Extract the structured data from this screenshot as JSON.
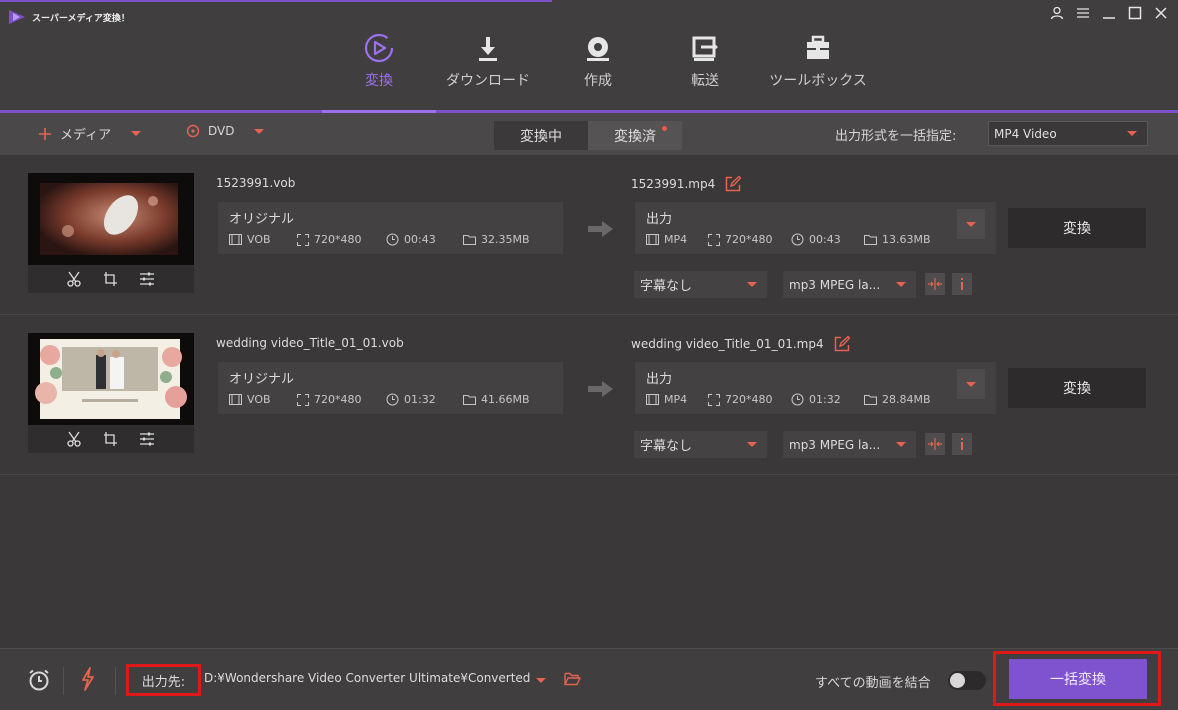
{
  "app": {
    "title": "スーパーメディア変換！"
  },
  "nav": [
    {
      "label": "変換",
      "icon": "convert-icon",
      "active": true
    },
    {
      "label": "ダウンロード",
      "icon": "download-icon"
    },
    {
      "label": "作成",
      "icon": "burn-disc-icon"
    },
    {
      "label": "転送",
      "icon": "transfer-icon"
    },
    {
      "label": "ツールボックス",
      "icon": "toolbox-icon"
    }
  ],
  "toolbar": {
    "add_media": "メディア",
    "dvd": "DVD",
    "tab_converting": "変換中",
    "tab_converted": "変換済",
    "format_label": "出力形式を一括指定:",
    "format_value": "MP4 Video"
  },
  "files": [
    {
      "source_name": "1523991.vob",
      "source_title": "オリジナル",
      "source": {
        "format": "VOB",
        "resolution": "720*480",
        "duration": "00:43",
        "size": "32.35MB"
      },
      "output_name": "1523991.mp4",
      "output_title": "出力",
      "output": {
        "format": "MP4",
        "resolution": "720*480",
        "duration": "00:43",
        "size": "13.63MB"
      },
      "convert_label": "変換",
      "subtitle": "字幕なし",
      "audio": "mp3 MPEG la..."
    },
    {
      "source_name": "wedding video_Title_01_01.vob",
      "source_title": "オリジナル",
      "source": {
        "format": "VOB",
        "resolution": "720*480",
        "duration": "01:32",
        "size": "41.66MB"
      },
      "output_name": "wedding video_Title_01_01.mp4",
      "output_title": "出力",
      "output": {
        "format": "MP4",
        "resolution": "720*480",
        "duration": "01:32",
        "size": "28.84MB"
      },
      "convert_label": "変換",
      "subtitle": "字幕なし",
      "audio": "mp3 MPEG la..."
    }
  ],
  "bottom": {
    "output_label": "出力先:",
    "output_path": "D:¥Wondershare Video Converter Ultimate¥Converted",
    "merge_label": "すべての動画を結合",
    "batch_convert": "一括変換"
  },
  "colors": {
    "accent": "#7f52d0",
    "highlight": "#e01818",
    "warning": "#e56350"
  }
}
